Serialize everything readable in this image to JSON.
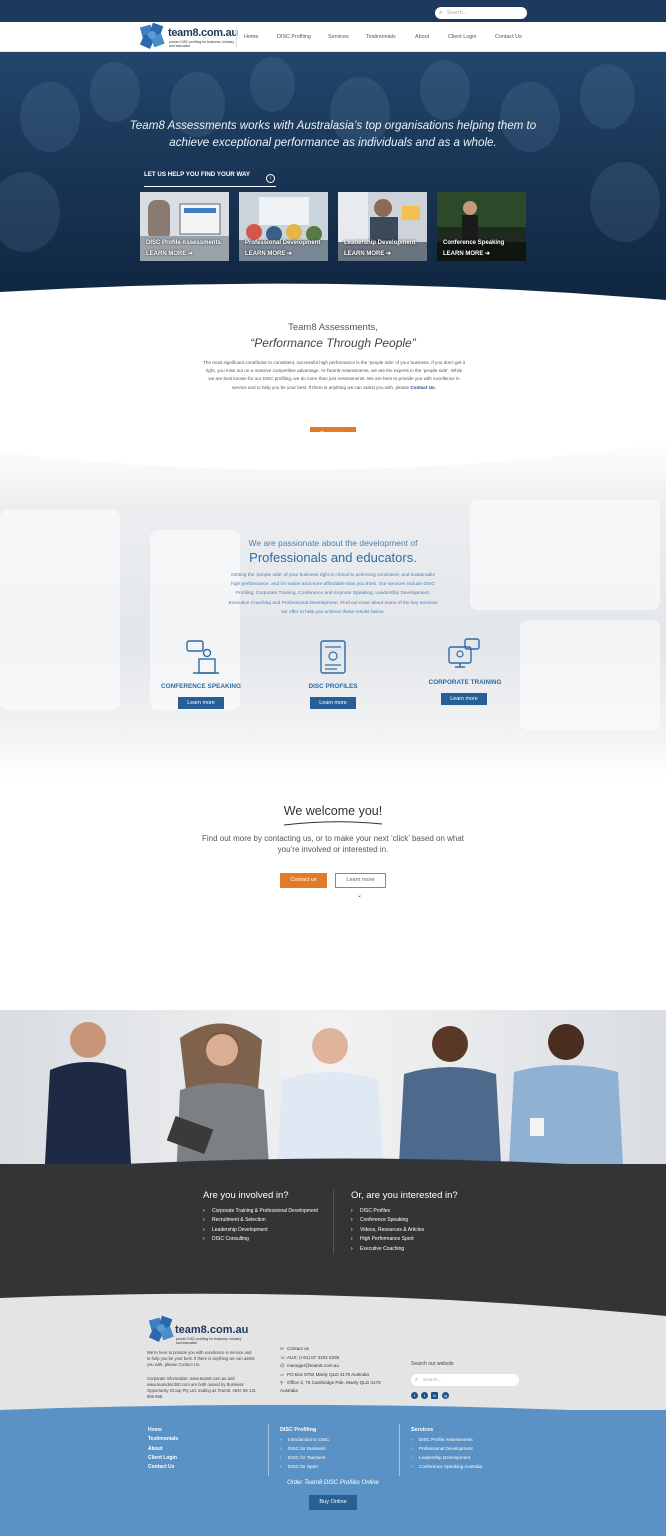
{
  "top": {
    "search_placeholder": "Search..."
  },
  "brand": {
    "name": "team8.com.au",
    "tagline": "proven DISC profiling for business, industry and education"
  },
  "nav": [
    "Home",
    "DISC Profiling",
    "Services",
    "Testimonials",
    "About",
    "Client Login",
    "Contact Us"
  ],
  "hero": {
    "title": "Team8 Assessments works with Australasia’s top organisations helping them to achieve exceptional performance as individuals and as a whole.",
    "finder": "LET US HELP YOU FIND YOUR WAY",
    "cards": [
      {
        "label": "DISC Profile Assessments",
        "more": "LEARN MORE"
      },
      {
        "label": "Professional Development",
        "more": "LEARN MORE"
      },
      {
        "label": "Leadership Development",
        "more": "LEARN MORE"
      },
      {
        "label": "Conference Speaking",
        "more": "LEARN MORE"
      }
    ]
  },
  "intro": {
    "pre": "Team8 Assessments,",
    "title": "“Performance Through People”",
    "body": "The most significant contributor to consistent, successful high performance is the ‘people side’ of your business. If you don’t get it right, you miss out on a massive competitive advantage. At Team8 Assessments, we are the experts in the ‘people side’. While we are best known for our DISC profiling, we do more than just Assessments. We are here to provide you with excellence in service and to help you be your best. If there is anything we can assist you with, please",
    "link": "Contact Us.",
    "button": "Contact us"
  },
  "passion": {
    "pre": "We are passionate about the development of",
    "title": "Professionals and educators.",
    "body": "Getting the ‘people side’ of your business right is critical to achieving consistent, and sustainable high performance, and it’s easier and more affordable than you think. Our services include DISC Profiling, Corporate Training, Conference and Keynote Speaking, Leadership Development, Executive Coaching and Professional Development. Find out more about some of the key services we offer to help you achieve these results below.",
    "services": [
      {
        "title": "CONFERENCE SPEAKING",
        "button": "Learn more"
      },
      {
        "title": "DISC PROFILES",
        "button": "Learn more"
      },
      {
        "title": "CORPORATE TRAINING",
        "button": "Learn more"
      }
    ]
  },
  "welcome": {
    "title": "We welcome you!",
    "body": "Find out more by contacting us, or to make your next ‘click’ based on what you’re involved or interested in.",
    "contact": "Contact us",
    "learn": "Learn more",
    "chevron": "⌄"
  },
  "involved": {
    "left_title": "Are you involved in?",
    "left_items": [
      "Corporate Training & Professional Development",
      "Recruitment & Selection",
      "Leadership Development",
      "DISC Consulting"
    ],
    "right_title": "Or, are you interested in?",
    "right_items": [
      "DISC Profiles",
      "Conference Speaking",
      "Videos, Resources & Articles",
      "High Performance Sport",
      "Executive Coaching"
    ]
  },
  "footer": {
    "about": "We’re here to provide you with excellence in service and to help you be your best. If there is anything we can assist you with, please",
    "about_link": "Contact Us.",
    "corporate": "Corporate information: www.team8.com.au and www.teamdisc360.com are both owned by Business Opportunity Group Pty Ltd, trading as Team8, ABN: 86 131 906 668.",
    "contact": [
      {
        "icon": "chat-icon",
        "glyph": "✉",
        "text": "Contact us"
      },
      {
        "icon": "phone-icon",
        "glyph": "☏",
        "text": "AUS: (+61) 07 3102 5335"
      },
      {
        "icon": "email-icon",
        "glyph": "@",
        "text": "manager@team8.com.au"
      },
      {
        "icon": "mail-icon",
        "glyph": "▭",
        "text": "PO Box 5782 Manly QLD 4179 Australia"
      },
      {
        "icon": "location-icon",
        "glyph": "⚲",
        "text": "Office 2, 75 Cambridge Pde, Manly QLD 4179 Australia"
      }
    ],
    "search_label": "Search our website",
    "search_placeholder": "Search...",
    "social": [
      "f",
      "t",
      "in",
      "ig"
    ],
    "links": [
      "Home",
      "Testimonials",
      "About",
      "Client Login",
      "Contact Us"
    ],
    "disc_title": "DISC Profiling",
    "disc_items": [
      "Introduction to DISC",
      "DISC for Business",
      "DISC for Teachers",
      "DISC for Sport"
    ],
    "services_title": "Services",
    "services_items": [
      "DISC Profile Assessments",
      "Professional Development",
      "Leadership Development",
      "Conference Speaking Australia"
    ],
    "order": "Order Team8 DISC Profiles Online",
    "buy": "Buy Online"
  },
  "colors": {
    "navy": "#1d3a5c",
    "orange": "#e07b2a",
    "blue": "#255f96",
    "footer_blue": "#5b92c5",
    "dark": "#333436"
  }
}
